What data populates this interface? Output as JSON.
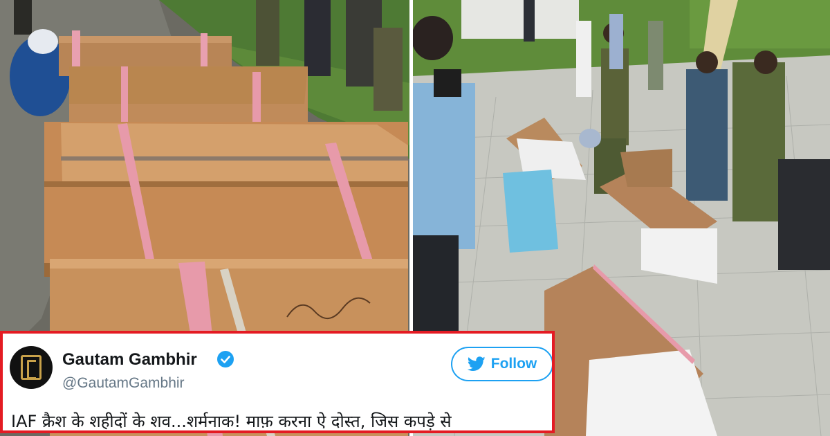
{
  "tweet": {
    "display_name": "Gautam Gambhir",
    "handle": "@GautamGambhir",
    "follow_label": "Follow",
    "text": "IAF क्रैश के शहीदों के शव...शर्मनाक! माफ़ करना ऐ दोस्त, जिस कपड़े से",
    "verified": true,
    "avatar_icon": "gg-logo-icon",
    "follow_icon": "twitter-bird-icon"
  },
  "colors": {
    "frame_border": "#e41b23",
    "twitter_blue": "#1da1f2",
    "name_text": "#14171a",
    "handle_text": "#657786",
    "cardboard": "#c68a55",
    "strap": "#e79aaa"
  }
}
